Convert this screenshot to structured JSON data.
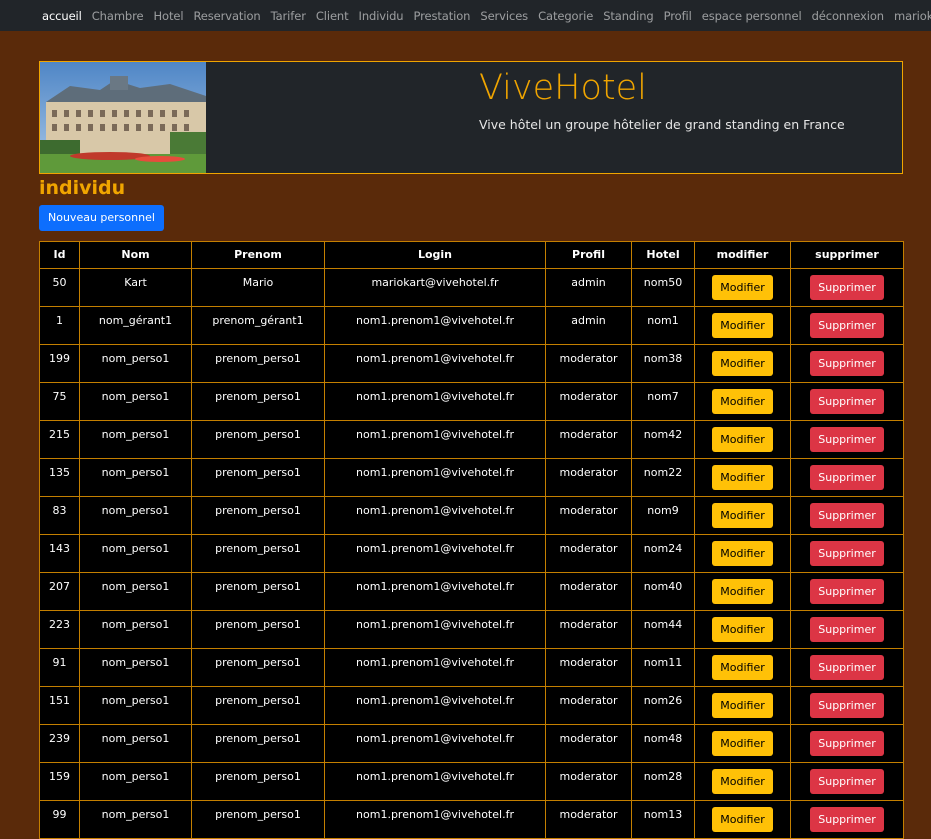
{
  "nav": {
    "items": [
      "accueil",
      "Chambre",
      "Hotel",
      "Reservation",
      "Tarifer",
      "Client",
      "Individu",
      "Prestation",
      "Services",
      "Categorie",
      "Standing",
      "Profil",
      "espace personnel",
      "déconnexion",
      "mariokart@vivehotel.fr"
    ]
  },
  "banner": {
    "title": "ViveHotel",
    "subtitle": "Vive hôtel un groupe hôtelier de grand standing en France"
  },
  "page": {
    "section_title": "individu",
    "new_button": "Nouveau personnel"
  },
  "table": {
    "headers": [
      "Id",
      "Nom",
      "Prenom",
      "Login",
      "Profil",
      "Hotel",
      "modifier",
      "supprimer"
    ],
    "edit_label": "Modifier",
    "delete_label": "Supprimer",
    "rows": [
      [
        "50",
        "Kart",
        "Mario",
        "mariokart@vivehotel.fr",
        "admin",
        "nom50"
      ],
      [
        "1",
        "nom_gérant1",
        "prenom_gérant1",
        "nom1.prenom1@vivehotel.fr",
        "admin",
        "nom1"
      ],
      [
        "199",
        "nom_perso1",
        "prenom_perso1",
        "nom1.prenom1@vivehotel.fr",
        "moderator",
        "nom38"
      ],
      [
        "75",
        "nom_perso1",
        "prenom_perso1",
        "nom1.prenom1@vivehotel.fr",
        "moderator",
        "nom7"
      ],
      [
        "215",
        "nom_perso1",
        "prenom_perso1",
        "nom1.prenom1@vivehotel.fr",
        "moderator",
        "nom42"
      ],
      [
        "135",
        "nom_perso1",
        "prenom_perso1",
        "nom1.prenom1@vivehotel.fr",
        "moderator",
        "nom22"
      ],
      [
        "83",
        "nom_perso1",
        "prenom_perso1",
        "nom1.prenom1@vivehotel.fr",
        "moderator",
        "nom9"
      ],
      [
        "143",
        "nom_perso1",
        "prenom_perso1",
        "nom1.prenom1@vivehotel.fr",
        "moderator",
        "nom24"
      ],
      [
        "207",
        "nom_perso1",
        "prenom_perso1",
        "nom1.prenom1@vivehotel.fr",
        "moderator",
        "nom40"
      ],
      [
        "223",
        "nom_perso1",
        "prenom_perso1",
        "nom1.prenom1@vivehotel.fr",
        "moderator",
        "nom44"
      ],
      [
        "91",
        "nom_perso1",
        "prenom_perso1",
        "nom1.prenom1@vivehotel.fr",
        "moderator",
        "nom11"
      ],
      [
        "151",
        "nom_perso1",
        "prenom_perso1",
        "nom1.prenom1@vivehotel.fr",
        "moderator",
        "nom26"
      ],
      [
        "239",
        "nom_perso1",
        "prenom_perso1",
        "nom1.prenom1@vivehotel.fr",
        "moderator",
        "nom48"
      ],
      [
        "159",
        "nom_perso1",
        "prenom_perso1",
        "nom1.prenom1@vivehotel.fr",
        "moderator",
        "nom28"
      ],
      [
        "99",
        "nom_perso1",
        "prenom_perso1",
        "nom1.prenom1@vivehotel.fr",
        "moderator",
        "nom13"
      ]
    ]
  },
  "colors": {
    "page_bg": "#5a2a0a",
    "accent": "#f0a500",
    "primary": "#0d6efd",
    "warning": "#ffc107",
    "danger": "#dc3545"
  }
}
